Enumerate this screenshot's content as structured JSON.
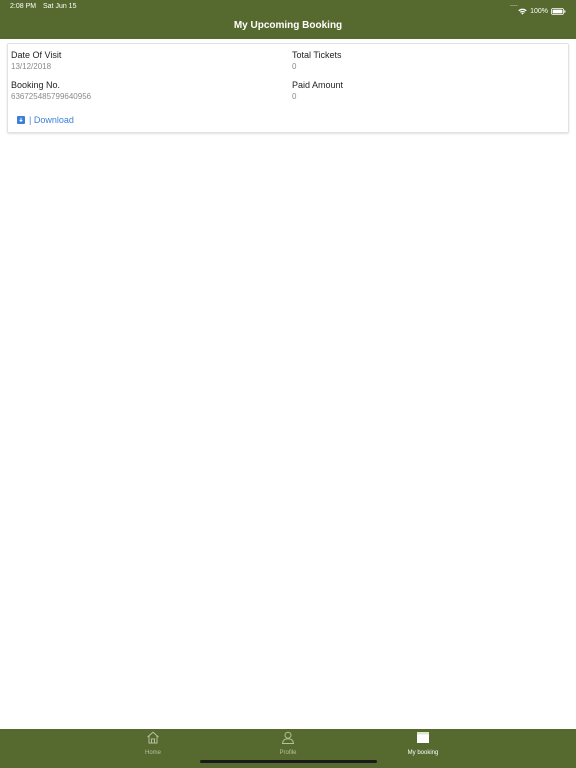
{
  "status_bar": {
    "time": "2:08 PM",
    "date": "Sat Jun 15",
    "signal_dots": "....",
    "battery_percent": "100%"
  },
  "header": {
    "title": "My Upcoming Booking",
    "background": "#56692e"
  },
  "booking": {
    "date_of_visit_label": "Date Of Visit",
    "date_of_visit_value": "13/12/2018",
    "total_tickets_label": "Total Tickets",
    "total_tickets_value": "0",
    "booking_no_label": "Booking No.",
    "booking_no_value": "636725485799640956",
    "paid_amount_label": "Paid Amount",
    "paid_amount_value": "0",
    "download_label": "| Download",
    "link_color": "#3d7fd6"
  },
  "tab_bar": {
    "tabs": [
      {
        "label": "Home",
        "icon": "home-icon",
        "active": false
      },
      {
        "label": "Profile",
        "icon": "person-icon",
        "active": false
      },
      {
        "label": "My booking",
        "icon": "calendar-icon",
        "active": true
      }
    ]
  }
}
